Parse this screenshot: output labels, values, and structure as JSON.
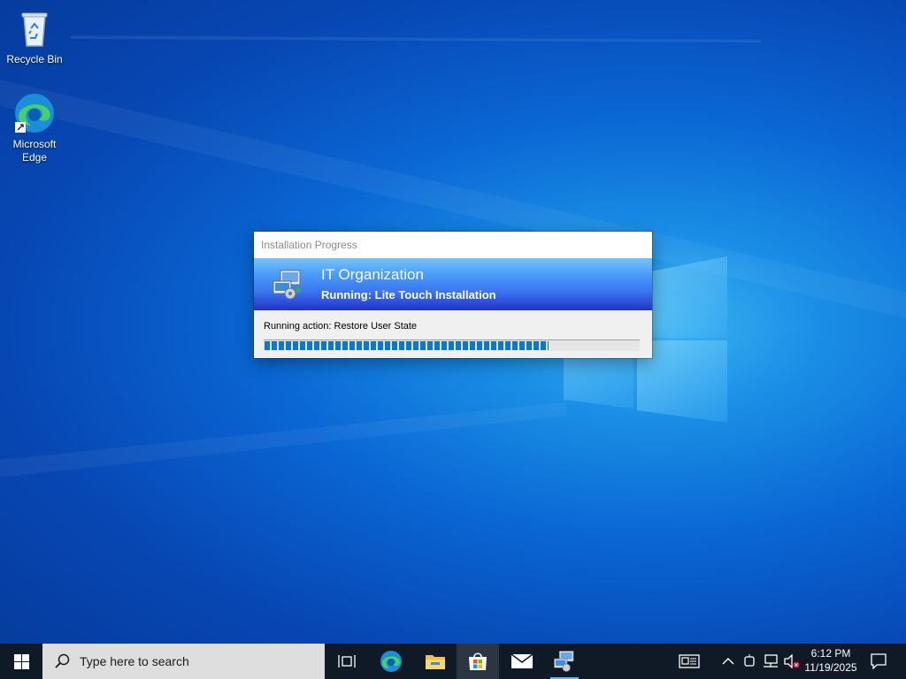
{
  "desktop": {
    "icons": [
      {
        "label": "Recycle Bin",
        "icon": "recycle-bin-icon"
      },
      {
        "label": "Microsoft Edge",
        "icon": "edge-icon"
      }
    ]
  },
  "dialog": {
    "title": "Installation Progress",
    "organization": "IT Organization",
    "status": "Running: Lite Touch Installation",
    "action": "Running action: Restore User State",
    "progress": 0.76,
    "progress_color": "#0a76d8"
  },
  "taskbar": {
    "search_placeholder": "Type here to search",
    "apps": [
      "task-view-icon",
      "edge-icon",
      "file-explorer-icon",
      "store-icon",
      "mail-icon",
      "deployment-icon"
    ],
    "clock": {
      "time": "6:12 PM",
      "date": "11/19/2025"
    },
    "colors": {
      "background": "#101a26",
      "search": "#dedede",
      "accent": "#6fb3f2"
    }
  }
}
